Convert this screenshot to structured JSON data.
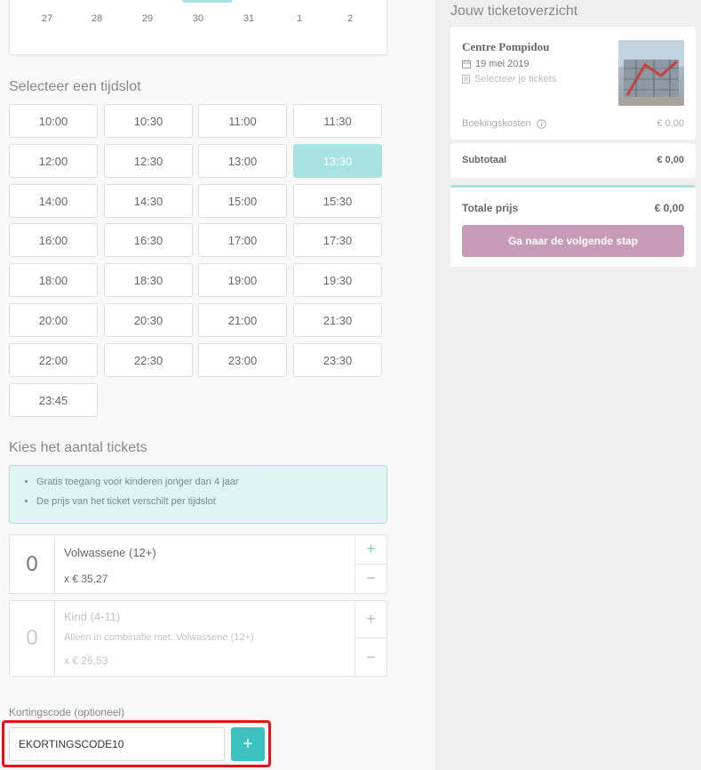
{
  "calendar": {
    "days": [
      "27",
      "28",
      "29",
      "30",
      "31",
      "1",
      "2"
    ],
    "selected_day": "30"
  },
  "timeslots": {
    "title": "Selecteer een tijdslot",
    "selected": "13:30",
    "slots": [
      "10:00",
      "10:30",
      "11:00",
      "11:30",
      "12:00",
      "12:30",
      "13:00",
      "13:30",
      "14:00",
      "14:30",
      "15:00",
      "15:30",
      "16:00",
      "16:30",
      "17:00",
      "17:30",
      "18:00",
      "18:30",
      "19:00",
      "19:30",
      "20:00",
      "20:30",
      "21:00",
      "21:30",
      "22:00",
      "22:30",
      "23:00",
      "23:30",
      "23:45"
    ]
  },
  "tickets": {
    "title": "Kies het aantal tickets",
    "info": [
      "Gratis toegang voor kinderen jonger dan 4 jaar",
      "De prijs van het ticket verschilt per tijdslot"
    ],
    "types": [
      {
        "count": "0",
        "name": "Volwassene (12+)",
        "price": "x € 35,27",
        "note": ""
      },
      {
        "count": "0",
        "name": "Kind (4-11)",
        "price": "x € 26,53",
        "note": "Alleen in combinatie met: Volwassene (12+)"
      }
    ],
    "plus": "+",
    "minus": "−"
  },
  "discount": {
    "label": "Kortingscode (optioneel)",
    "value": "EKORTINGSCODE10",
    "add": "+"
  },
  "overview": {
    "title": "Jouw ticketoverzicht",
    "venue": "Centre Pompidou",
    "date": "19 mei 2019",
    "tickets_hint": "Selecteer je tickets",
    "booking_label": "Boekingskosten",
    "booking_value": "€ 0,00",
    "subtotal_label": "Subtotaal",
    "subtotal_value": "€ 0,00",
    "total_label": "Totale prijs",
    "total_value": "€ 0,00",
    "next_button": "Ga naar de volgende stap"
  }
}
